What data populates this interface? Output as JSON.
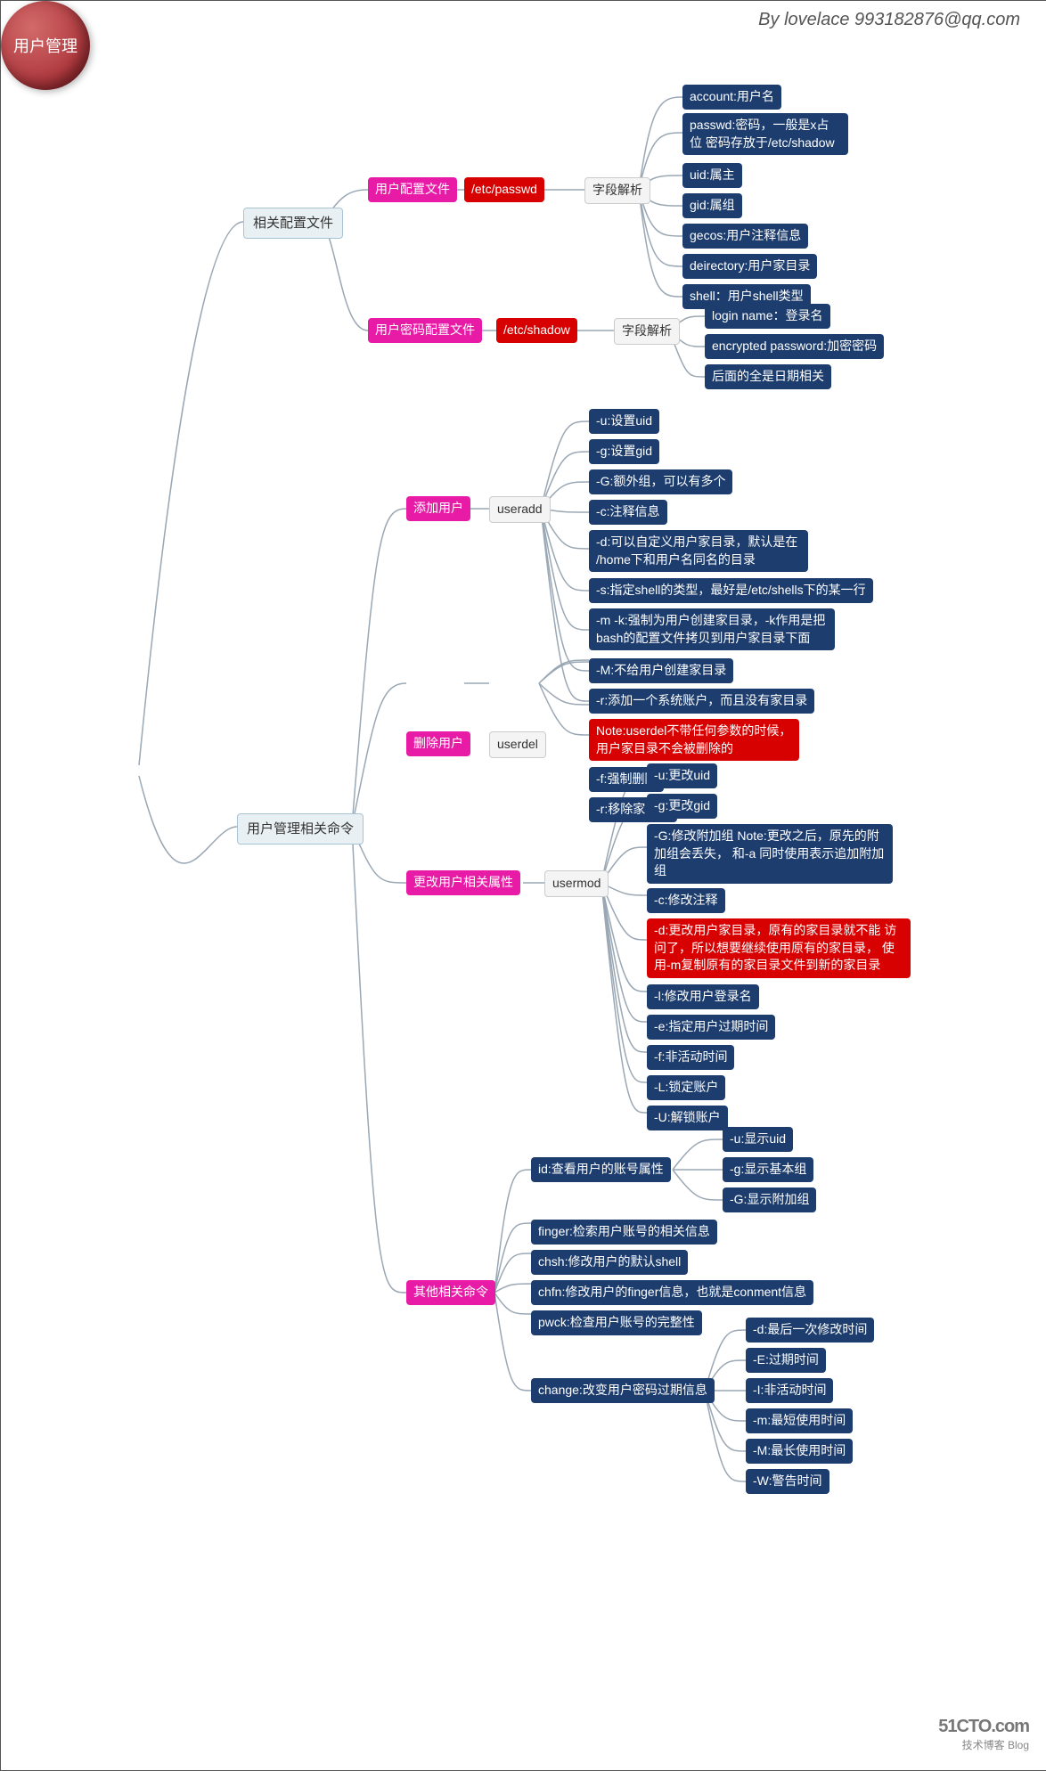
{
  "credit": "By lovelace 993182876@qq.com",
  "root": "用户管理",
  "branch1": "相关配置文件",
  "branch2": "用户管理相关命令",
  "cfg1": "用户配置文件",
  "cfg1_file": "/etc/passwd",
  "cfg1_field": "字段解析",
  "cfg1_items": {
    "i0": "account:用户名",
    "i1": "passwd:密码，一般是x占位\n密码存放于/etc/shadow",
    "i2": "uid:属主",
    "i3": "gid:属组",
    "i4": "gecos:用户注释信息",
    "i5": "deirectory:用户家目录",
    "i6": "shell：用户shell类型"
  },
  "cfg2": "用户密码配置文件",
  "cfg2_file": "/etc/shadow",
  "cfg2_field": "字段解析",
  "cfg2_items": {
    "i0": "login name：登录名",
    "i1": "encrypted password:加密密码",
    "i2": "后面的全是日期相关"
  },
  "cmd_add_label": "添加用户",
  "cmd_add_tool": "useradd",
  "cmd_add_items": {
    "i0": "-u:设置uid",
    "i1": "-g:设置gid",
    "i2": "-G:额外组，可以有多个",
    "i3": "-c:注释信息",
    "i4": "-d:可以自定义用户家目录，默认是在\n/home下和用户名同名的目录",
    "i5": "-s:指定shell的类型，最好是/etc/shells下的某一行",
    "i6": "-m -k:强制为用户创建家目录，-k作用是把\nbash的配置文件拷贝到用户家目录下面",
    "i7": "-M:不给用户创建家目录",
    "i8": "-r:添加一个系统账户，而且没有家目录"
  },
  "cmd_del_label": "删除用户",
  "cmd_del_tool": "userdel",
  "cmd_del_items": {
    "i0": "Note:userdel不带任何参数的时候，\n用户家目录不会被删除的",
    "i1": "-f:强制删除",
    "i2": "-r:移除家目录"
  },
  "cmd_mod_label": "更改用户相关属性",
  "cmd_mod_tool": "usermod",
  "cmd_mod_items": {
    "i0": "-u:更改uid",
    "i1": "-g:更改gid",
    "i2": "-G:修改附加组\nNote:更改之后，原先的附加组会丢失，\n和-a 同时使用表示追加附加组",
    "i3": "-c:修改注释",
    "i4": "-d:更改用户家目录，原有的家目录就不能\n访问了，所以想要继续使用原有的家目录，\n使用-m复制原有的家目录文件到新的家目录",
    "i5": "-l:修改用户登录名",
    "i6": "-e:指定用户过期时间",
    "i7": "-f:非活动时间",
    "i8": "-L:锁定账户",
    "i9": "-U:解锁账户"
  },
  "cmd_other_label": "其他相关命令",
  "cmd_other_id": "id:查看用户的账号属性",
  "cmd_other_id_items": {
    "i0": "-u:显示uid",
    "i1": "-g:显示基本组",
    "i2": "-G:显示附加组"
  },
  "cmd_other_items": {
    "i0": "finger:检索用户账号的相关信息",
    "i1": "chsh:修改用户的默认shell",
    "i2": "chfn:修改用户的finger信息，也就是conment信息",
    "i3": "pwck:检查用户账号的完整性"
  },
  "cmd_other_change": "change:改变用户密码过期信息",
  "cmd_other_change_items": {
    "i0": "-d:最后一次修改时间",
    "i1": "-E:过期时间",
    "i2": "-I:非活动时间",
    "i3": "-m:最短使用时间",
    "i4": "-M:最长使用时间",
    "i5": "-W:警告时间"
  },
  "watermark": {
    "big": "51CTO.com",
    "small": "技术博客    Blog"
  }
}
